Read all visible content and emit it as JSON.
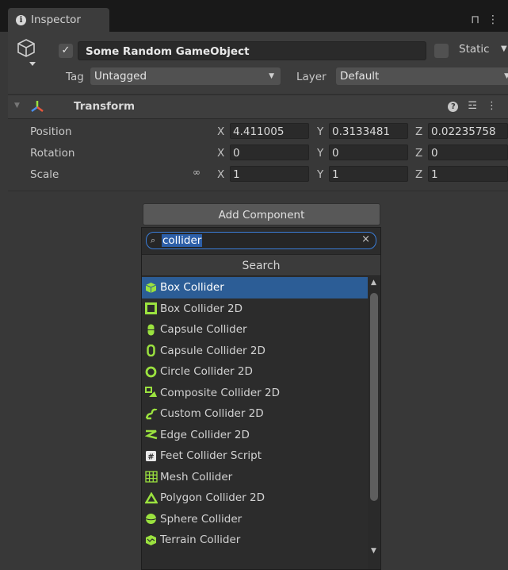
{
  "tab": {
    "title": "Inspector"
  },
  "header": {
    "name": "Some Random GameObject",
    "static_label": "Static",
    "tag_label": "Tag",
    "tag_value": "Untagged",
    "layer_label": "Layer",
    "layer_value": "Default"
  },
  "transform": {
    "title": "Transform",
    "rows": [
      {
        "label": "Position",
        "x": "4.411005",
        "y": "0.3133481",
        "z": "0.02235758"
      },
      {
        "label": "Rotation",
        "x": "0",
        "y": "0",
        "z": "0"
      },
      {
        "label": "Scale",
        "x": "1",
        "y": "1",
        "z": "1"
      }
    ],
    "axis_x": "X",
    "axis_y": "Y",
    "axis_z": "Z"
  },
  "add_component": {
    "button_label": "Add Component",
    "search_value": "collider",
    "search_header": "Search",
    "items": [
      {
        "label": "Box Collider",
        "icon": "box-collider-icon",
        "selected": true
      },
      {
        "label": "Box Collider 2D",
        "icon": "box-collider-2d-icon"
      },
      {
        "label": "Capsule Collider",
        "icon": "capsule-collider-icon"
      },
      {
        "label": "Capsule Collider 2D",
        "icon": "capsule-collider-2d-icon"
      },
      {
        "label": "Circle Collider 2D",
        "icon": "circle-collider-2d-icon"
      },
      {
        "label": "Composite Collider 2D",
        "icon": "composite-collider-2d-icon"
      },
      {
        "label": "Custom Collider 2D",
        "icon": "custom-collider-2d-icon"
      },
      {
        "label": "Edge Collider 2D",
        "icon": "edge-collider-2d-icon"
      },
      {
        "label": "Feet Collider Script",
        "icon": "script-icon"
      },
      {
        "label": "Mesh Collider",
        "icon": "mesh-collider-icon"
      },
      {
        "label": "Polygon Collider 2D",
        "icon": "polygon-collider-2d-icon"
      },
      {
        "label": "Sphere Collider",
        "icon": "sphere-collider-icon"
      },
      {
        "label": "Terrain Collider",
        "icon": "terrain-collider-icon"
      }
    ]
  },
  "colors": {
    "accent_green": "#9be23f",
    "selection_blue": "#2c5d96"
  }
}
